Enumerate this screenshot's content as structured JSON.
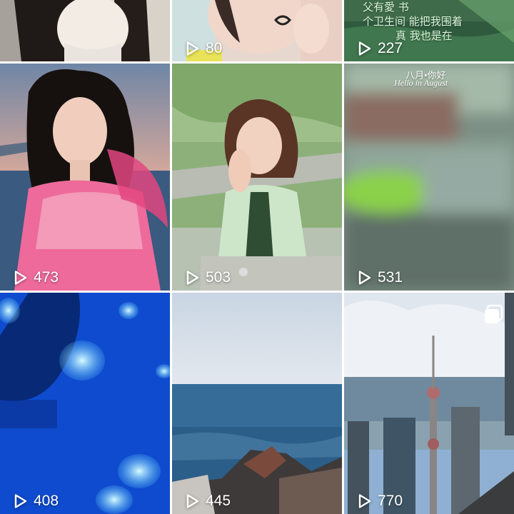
{
  "tiles": [
    {
      "id": "r1c1",
      "play_count": "",
      "kind": "portrait-top"
    },
    {
      "id": "r1c2",
      "play_count": "80",
      "kind": "selfie"
    },
    {
      "id": "r1c3",
      "play_count": "227",
      "kind": "river-text"
    },
    {
      "id": "r2c1",
      "play_count": "473",
      "kind": "pink-dress-portrait"
    },
    {
      "id": "r2c2",
      "play_count": "503",
      "kind": "park-portrait"
    },
    {
      "id": "r2c3",
      "play_count": "531",
      "kind": "blurred-river",
      "overlay_title": "八月•你好",
      "overlay_subtitle": "Hello in August"
    },
    {
      "id": "r3c1",
      "play_count": "408",
      "kind": "jellyfish-aquarium"
    },
    {
      "id": "r3c2",
      "play_count": "445",
      "kind": "sea-rocks"
    },
    {
      "id": "r3c3",
      "play_count": "770",
      "kind": "city-skyline",
      "multi_icon": "multi-photo-icon"
    }
  ],
  "r1c3_overlay_lines": [
    "父有愛 书",
    "个卫生间 能把我围着",
    "真 我也是在"
  ],
  "colors": {
    "count_text": "#ffffff",
    "background": "#ffffff"
  }
}
